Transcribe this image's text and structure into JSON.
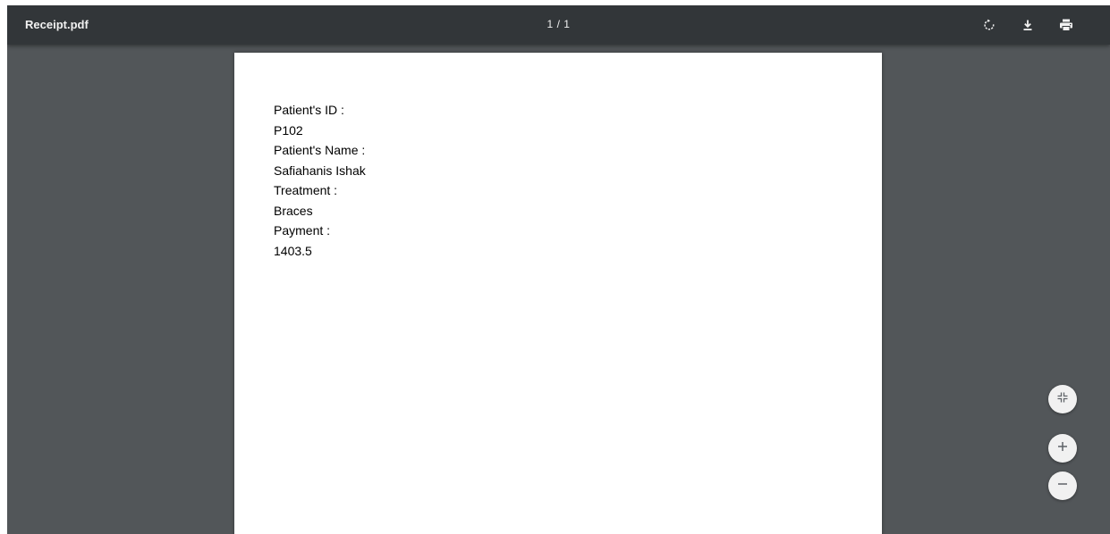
{
  "toolbar": {
    "file_name": "Receipt.pdf",
    "current_page": "1",
    "page_separator": "/",
    "total_pages": "1",
    "buttons": [
      {
        "name": "rotate-button",
        "icon": "rotate-icon"
      },
      {
        "name": "download-button",
        "icon": "download-icon"
      },
      {
        "name": "print-button",
        "icon": "print-icon"
      }
    ]
  },
  "document": {
    "lines": [
      {
        "label": "Patient's ID :",
        "value": "P102"
      },
      {
        "label": "Patient's Name :",
        "value": "Safiahanis Ishak"
      },
      {
        "label": "Treatment :",
        "value": "Braces"
      },
      {
        "label": "Payment :",
        "value": "1403.5"
      }
    ]
  },
  "zoom_controls": {
    "fit": {
      "icon": "fit-to-page-icon"
    },
    "zoom_in": {
      "label": "+",
      "icon": "zoom-in-icon"
    },
    "zoom_out": {
      "label": "−",
      "icon": "zoom-out-icon"
    }
  },
  "colors": {
    "toolbar_bg": "#323639",
    "viewer_bg": "#525659",
    "page_bg": "#ffffff",
    "toolbar_text": "#f1f1f1"
  }
}
